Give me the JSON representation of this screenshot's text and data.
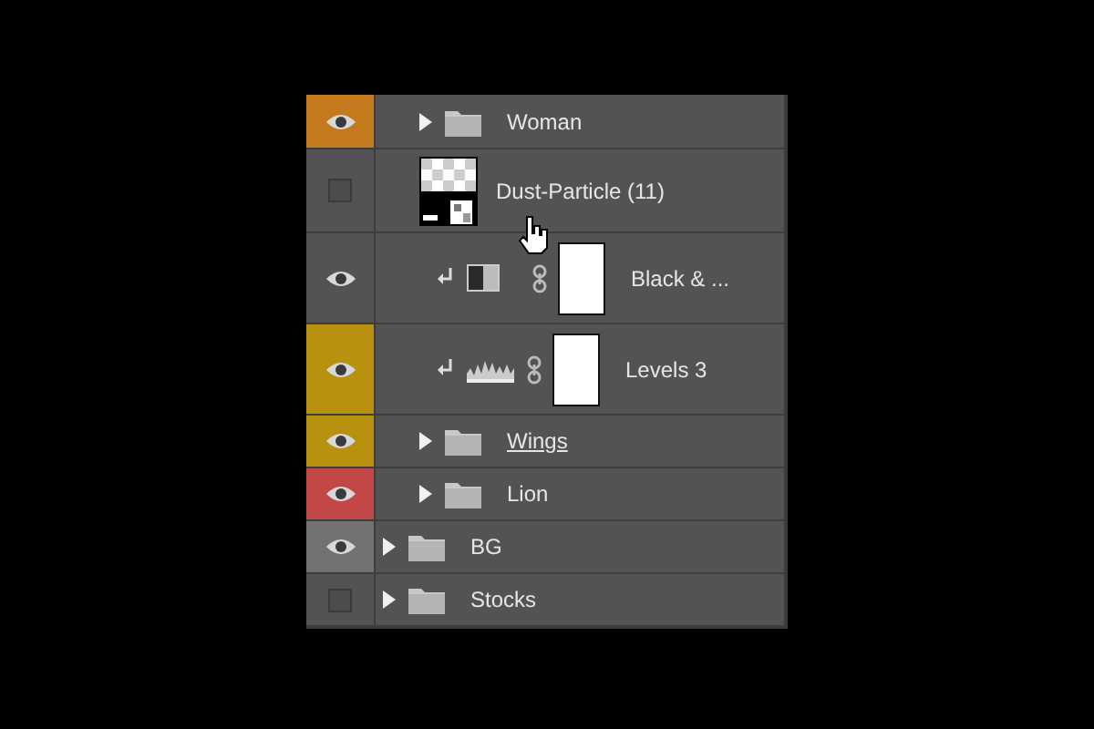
{
  "layers": [
    {
      "kind": "offscreen-group",
      "children": [
        {
          "kind": "group",
          "name": "Woman",
          "visible": true,
          "color": "#c47a1c",
          "expanded": false
        },
        {
          "kind": "smart",
          "name": "Dust-Particle (11)",
          "visible": false,
          "pointer": true
        },
        {
          "kind": "bw-adjustment",
          "name": "Black & ...",
          "visible": true,
          "clipped": true
        },
        {
          "kind": "levels-adjustment",
          "name": "Levels 3",
          "visible": true,
          "color": "#b8920f",
          "clipped": true
        },
        {
          "kind": "group",
          "name": "Wings",
          "visible": true,
          "color": "#b8920f",
          "expanded": false,
          "editing": true
        },
        {
          "kind": "group",
          "name": "Lion",
          "visible": true,
          "color": "#c24848",
          "expanded": false
        }
      ]
    },
    {
      "kind": "group",
      "name": "BG",
      "visible": true,
      "color": "#727272",
      "expanded": false
    },
    {
      "kind": "group",
      "name": "Stocks",
      "visible": false,
      "expanded": false
    }
  ]
}
